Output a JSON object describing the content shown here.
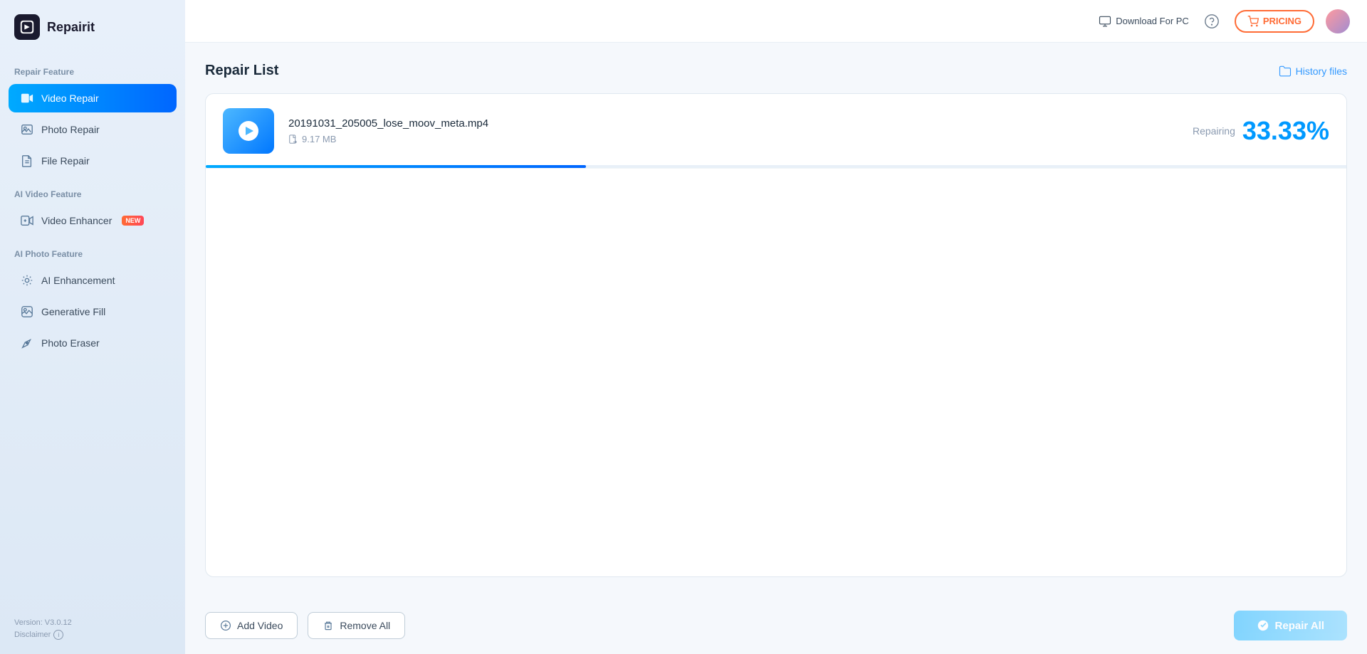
{
  "app": {
    "name": "Repairit"
  },
  "header": {
    "download_label": "Download For PC",
    "pricing_label": "PRICING"
  },
  "sidebar": {
    "repair_feature_label": "Repair Feature",
    "active_item": "video-repair",
    "repair_items": [
      {
        "id": "video-repair",
        "label": "Video Repair",
        "icon": "video-repair-icon"
      },
      {
        "id": "photo-repair",
        "label": "Photo Repair",
        "icon": "photo-repair-icon"
      },
      {
        "id": "file-repair",
        "label": "File Repair",
        "icon": "file-repair-icon"
      }
    ],
    "ai_video_label": "AI Video Feature",
    "ai_video_items": [
      {
        "id": "video-enhancer",
        "label": "Video Enhancer",
        "icon": "video-enhancer-icon",
        "badge": "NEW"
      }
    ],
    "ai_photo_label": "AI Photo Feature",
    "ai_photo_items": [
      {
        "id": "ai-enhancement",
        "label": "AI Enhancement",
        "icon": "ai-enhancement-icon"
      },
      {
        "id": "generative-fill",
        "label": "Generative Fill",
        "icon": "generative-fill-icon"
      },
      {
        "id": "photo-eraser",
        "label": "Photo Eraser",
        "icon": "photo-eraser-icon"
      }
    ],
    "version": "Version: V3.0.12",
    "disclaimer": "Disclaimer"
  },
  "main": {
    "repair_list_title": "Repair List",
    "history_files_label": "History files",
    "files": [
      {
        "id": "file-1",
        "name": "20191031_205005_lose_moov_meta.mp4",
        "size": "9.17 MB",
        "status": "Repairing",
        "percent": "33.33%",
        "progress": 33.33
      }
    ]
  },
  "footer": {
    "add_video_label": "Add Video",
    "remove_all_label": "Remove All",
    "repair_all_label": "Repair All"
  }
}
